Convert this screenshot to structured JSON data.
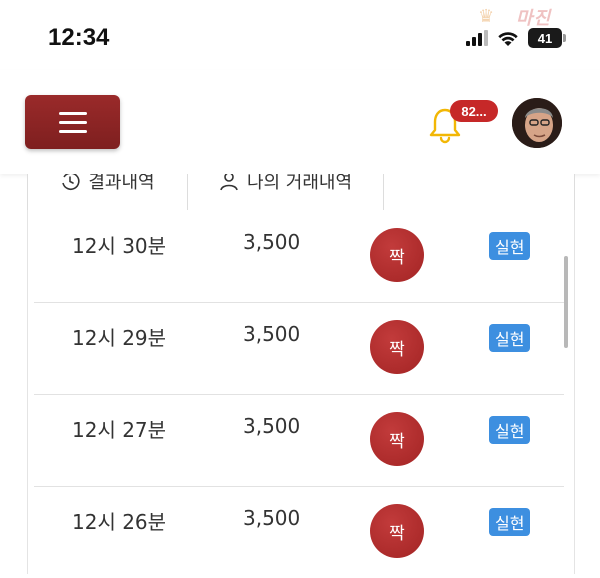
{
  "status_bar": {
    "time": "12:34",
    "battery": "41",
    "watermark": "마진"
  },
  "header": {
    "notification_count": "82..."
  },
  "tabs": [
    {
      "label": "결과내역",
      "icon": "history-icon"
    },
    {
      "label": "나의 거래내역",
      "icon": "user-icon"
    },
    {
      "label": ""
    }
  ],
  "rows": [
    {
      "time": "12시 30분",
      "amount": "3,500",
      "result": "짝",
      "status": "실현"
    },
    {
      "time": "12시 29분",
      "amount": "3,500",
      "result": "짝",
      "status": "실현"
    },
    {
      "time": "12시 27분",
      "amount": "3,500",
      "result": "짝",
      "status": "실현"
    },
    {
      "time": "12시 26분",
      "amount": "3,500",
      "result": "짝",
      "status": "실현"
    }
  ],
  "colors": {
    "brand": "#8b2323",
    "result_ball": "#a32424",
    "status_badge": "#3d8fe0",
    "notification_badge": "#c62828",
    "bell": "#f2b705"
  }
}
